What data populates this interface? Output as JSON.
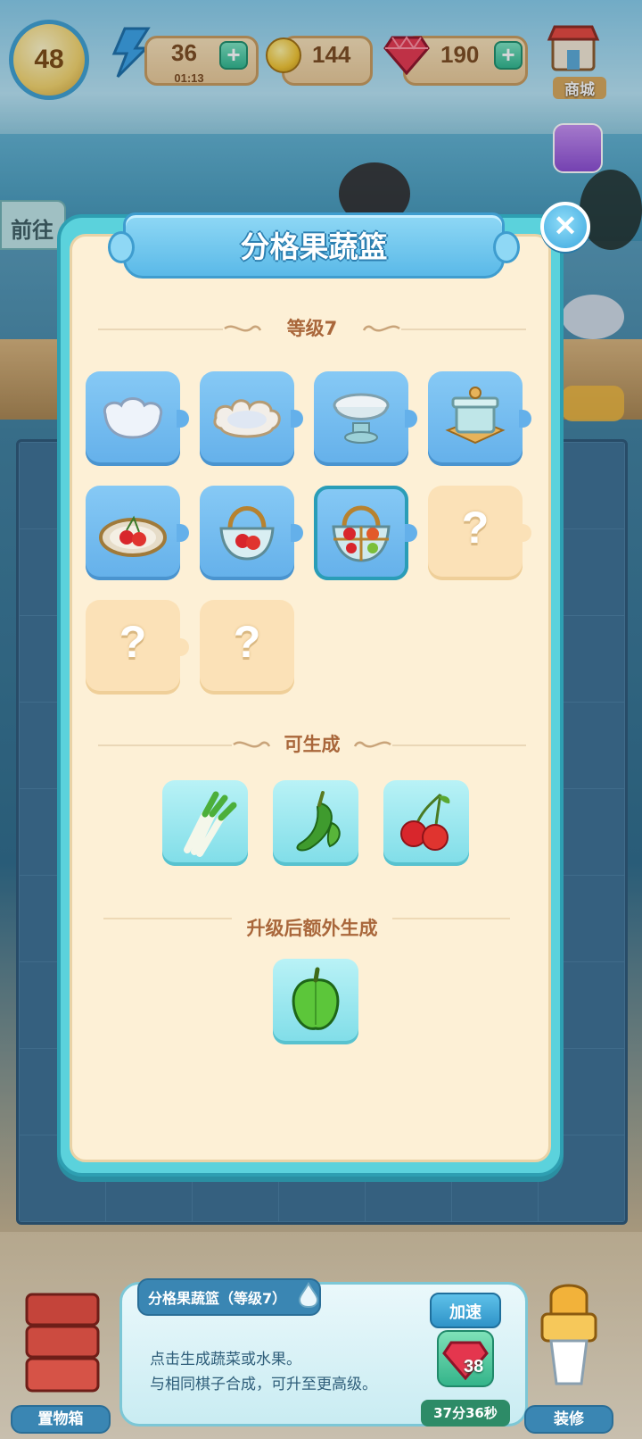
{
  "hud": {
    "level": "48",
    "energy": "36",
    "energy_timer": "01:13",
    "coins": "144",
    "gems": "190",
    "shop_label": "商城"
  },
  "side": {
    "goto_label": "前往"
  },
  "modal": {
    "title": "分格果蔬篮",
    "level_section": "等级7",
    "chain": [
      {
        "item": "cloud-shaped-bowl",
        "state": "unlocked"
      },
      {
        "item": "flower-dish",
        "state": "unlocked"
      },
      {
        "item": "footed-bowl",
        "state": "unlocked"
      },
      {
        "item": "lidded-box",
        "state": "unlocked"
      },
      {
        "item": "cherry-tray",
        "state": "unlocked"
      },
      {
        "item": "cherry-basket",
        "state": "unlocked"
      },
      {
        "item": "divided-fruit-basket",
        "state": "current"
      },
      {
        "item": "unknown",
        "state": "locked",
        "label": "?"
      },
      {
        "item": "unknown",
        "state": "locked",
        "label": "?"
      },
      {
        "item": "unknown",
        "state": "locked",
        "label": "?"
      }
    ],
    "generates_section": "可生成",
    "generates": [
      "green-onion",
      "green-pepper",
      "cherry"
    ],
    "upgrade_section": "升级后额外生成",
    "upgrade_generates": [
      "bell-pepper"
    ]
  },
  "info": {
    "title": "分格果蔬篮（等级7）",
    "line1": "点击生成蔬菜或水果。",
    "line2": "与相同棋子合成，可升至更高级。",
    "speed_label": "加速",
    "speed_cost": "38",
    "speed_timer": "37分36秒"
  },
  "bottom": {
    "storage_label": "置物箱",
    "decor_label": "装修"
  },
  "colors": {
    "modal_frame": "#5bd2dc",
    "modal_bg": "#fdf0d6",
    "tile_unlocked": "#64b0ea",
    "tile_locked": "#fbe1b7",
    "section_text": "#a9673b"
  }
}
